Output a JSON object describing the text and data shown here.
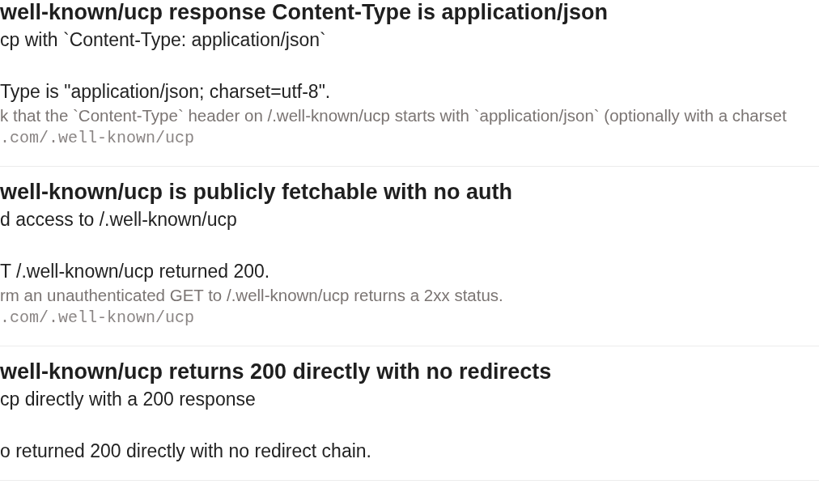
{
  "checks": [
    {
      "title": "well-known/ucp response Content-Type is application/json",
      "description": "cp with `Content-Type: application/json`",
      "result": "Type is \"application/json; charset=utf-8\".",
      "detail": "k that the `Content-Type` header on /.well-known/ucp starts with `application/json` (optionally with a charset",
      "url": ".com/.well-known/ucp"
    },
    {
      "title": "well-known/ucp is publicly fetchable with no auth",
      "description": "d access to /.well-known/ucp",
      "result": "T /.well-known/ucp returned 200.",
      "detail": "rm an unauthenticated GET to /.well-known/ucp returns a 2xx status.",
      "url": ".com/.well-known/ucp"
    },
    {
      "title": "well-known/ucp returns 200 directly with no redirects",
      "description": "cp directly with a 200 response",
      "result": "o returned 200 directly with no redirect chain."
    }
  ]
}
